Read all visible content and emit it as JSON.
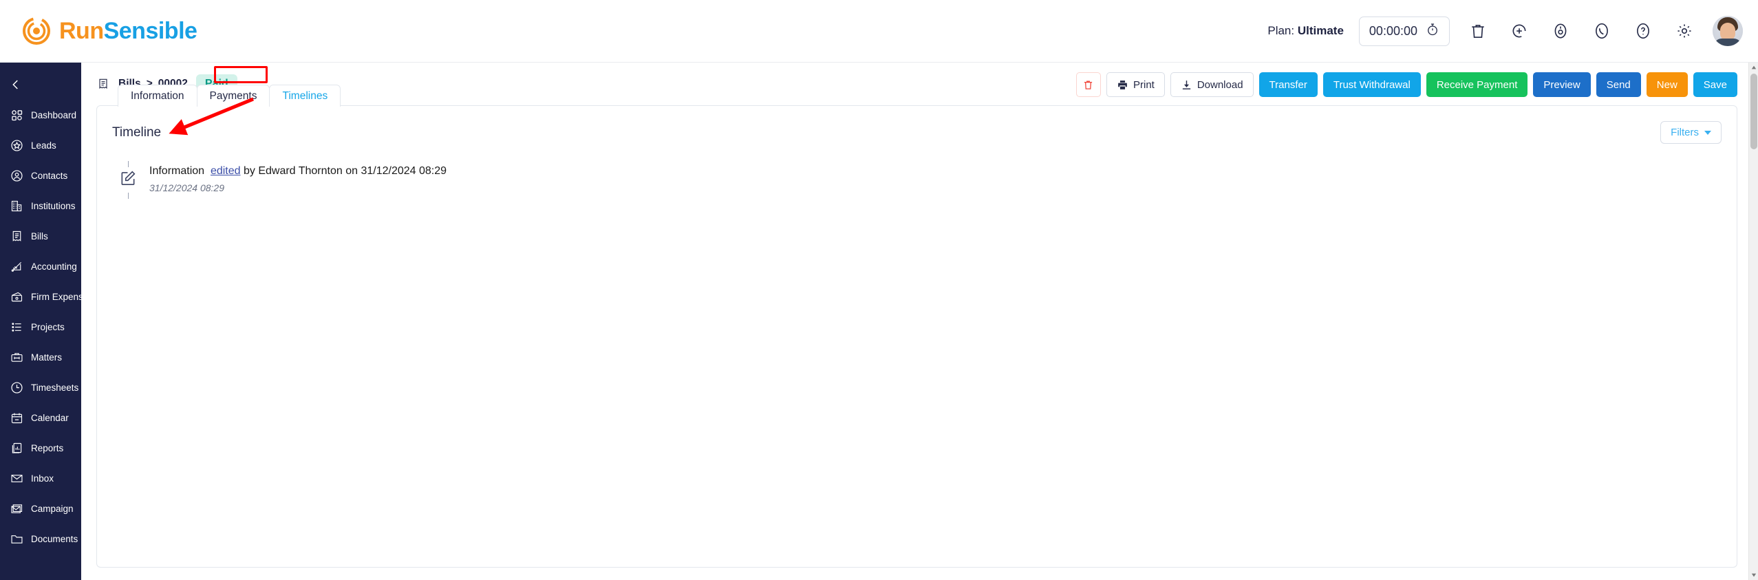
{
  "brand": {
    "name_part1": "Run",
    "name_part2": "Sensible",
    "color_orange": "#F6921E",
    "color_blue": "#18A0E4",
    "logo_icon": "sunburst-ring-icon"
  },
  "header": {
    "plan_label": "Plan:",
    "plan_value": "Ultimate",
    "timer_value": "00:00:00",
    "timer_icon": "stopwatch-icon",
    "icons": [
      {
        "name": "trash-icon",
        "glyph": "trash"
      },
      {
        "name": "add-circle-icon",
        "glyph": "add"
      },
      {
        "name": "notification-bell-icon",
        "glyph": "bell"
      },
      {
        "name": "phone-icon",
        "glyph": "phone"
      },
      {
        "name": "help-icon",
        "glyph": "help"
      },
      {
        "name": "settings-gear-icon",
        "glyph": "gear"
      }
    ],
    "avatar_alt": "User profile photo"
  },
  "sidebar": {
    "collapse_icon": "chevron-left-icon",
    "background": "#1b2045",
    "items": [
      {
        "label": "Dashboard",
        "icon": "dashboard-grid-icon"
      },
      {
        "label": "Leads",
        "icon": "star-badge-icon"
      },
      {
        "label": "Contacts",
        "icon": "person-circle-icon"
      },
      {
        "label": "Institutions",
        "icon": "building-icon"
      },
      {
        "label": "Bills",
        "icon": "receipt-icon"
      },
      {
        "label": "Accounting",
        "icon": "chart-pen-icon"
      },
      {
        "label": "Firm Expenses",
        "icon": "wallet-icon"
      },
      {
        "label": "Projects",
        "icon": "list-icon"
      },
      {
        "label": "Matters",
        "icon": "briefcase-icon"
      },
      {
        "label": "Timesheets",
        "icon": "clock-icon"
      },
      {
        "label": "Calendar",
        "icon": "calendar-icon"
      },
      {
        "label": "Reports",
        "icon": "report-chart-icon"
      },
      {
        "label": "Inbox",
        "icon": "envelope-icon"
      },
      {
        "label": "Campaign",
        "icon": "campaign-mail-icon"
      },
      {
        "label": "Documents",
        "icon": "folder-icon"
      }
    ]
  },
  "breadcrumb": {
    "icon": "receipt-icon",
    "root": "Bills",
    "separator": ">",
    "current": "00002",
    "status_badge": "Paid",
    "status_color": "#0c9b86",
    "status_bg": "#d3f2ea"
  },
  "actions": {
    "delete_icon": "trash-icon",
    "print_label": "Print",
    "print_icon": "printer-icon",
    "download_label": "Download",
    "download_icon": "download-icon",
    "transfer_label": "Transfer",
    "trust_withdrawal_label": "Trust Withdrawal",
    "receive_payment_label": "Receive Payment",
    "preview_label": "Preview",
    "send_label": "Send",
    "new_label": "New",
    "save_label": "Save",
    "colors": {
      "cyan": "#11a5e8",
      "green": "#16c25c",
      "blue": "#1d6fc9",
      "orange": "#f7930a",
      "danger": "#f04438"
    }
  },
  "tabs": [
    {
      "label": "Information",
      "active": false
    },
    {
      "label": "Payments",
      "active": false
    },
    {
      "label": "Timelines",
      "active": true
    }
  ],
  "main": {
    "title": "Timeline",
    "filters_label": "Filters",
    "filters_caret": "chevron-down-icon",
    "entries": [
      {
        "icon": "edit-square-icon",
        "subject": "Information",
        "action": "edited",
        "by_text": "by Edward Thornton on 31/12/2024 08:29",
        "timestamp": "31/12/2024 08:29"
      }
    ]
  },
  "annotations": {
    "highlight_color": "#ff0000",
    "arrow_target": "timeline-entry-edited-link",
    "box_target": "tab-timelines"
  }
}
